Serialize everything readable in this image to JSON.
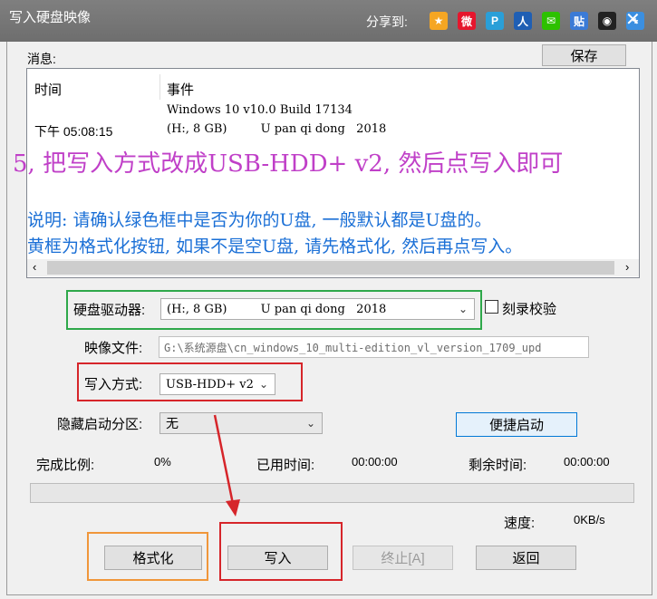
{
  "window": {
    "title": "写入硬盘映像",
    "share_label": "分享到:"
  },
  "share_icons": [
    {
      "icon": "qzone-star-icon",
      "glyph": "★",
      "color": "#f5a623"
    },
    {
      "icon": "weibo-icon",
      "glyph": "微",
      "color": "#e6162d"
    },
    {
      "icon": "tencent-weibo-icon",
      "glyph": "P",
      "color": "#2a9fd8"
    },
    {
      "icon": "renren-icon",
      "glyph": "人",
      "color": "#1f5fb4"
    },
    {
      "icon": "wechat-icon",
      "glyph": "✉",
      "color": "#2dc100"
    },
    {
      "icon": "tieba-icon",
      "glyph": "贴",
      "color": "#3b7bd6"
    },
    {
      "icon": "qq-penguin-icon",
      "glyph": "◉",
      "color": "#222222"
    },
    {
      "icon": "more-plus-icon",
      "glyph": "+",
      "color": "#3b8fe0"
    }
  ],
  "message": {
    "label": "消息:",
    "save_button": "保存",
    "col_time": "时间",
    "col_event": "事件",
    "rows": [
      {
        "time": "",
        "event": "Windows 10 v10.0 Build 17134"
      },
      {
        "time": "下午 05:08:15",
        "event": "(H:, 8 GB)         U pan qi dong   2018"
      }
    ]
  },
  "overlay": {
    "step": "5, 把写入方式改成USB-HDD+ v2, 然后点写入即可",
    "note1": "说明: 请确认绿色框中是否为你的U盘, 一般默认都是U盘的。",
    "note2": "黄框为格式化按钮, 如果不是空U盘, 请先格式化, 然后再点写入。"
  },
  "form": {
    "drive_label": "硬盘驱动器:",
    "drive_value": "(H:, 8 GB)         U pan qi dong   2018",
    "verify_label": "刻录校验",
    "image_label": "映像文件:",
    "image_value": "G:\\系统源盘\\cn_windows_10_multi-edition_vl_version_1709_upd",
    "write_mode_label": "写入方式:",
    "write_mode_value": "USB-HDD+ v2",
    "hidden_partition_label": "隐藏启动分区:",
    "hidden_partition_value": "无",
    "quick_boot_button": "便捷启动"
  },
  "status": {
    "complete_label": "完成比例:",
    "complete_value": "0%",
    "elapsed_label": "已用时间:",
    "elapsed_value": "00:00:00",
    "remaining_label": "剩余时间:",
    "remaining_value": "00:00:00",
    "speed_label": "速度:",
    "speed_value": "0KB/s",
    "progress": 0
  },
  "buttons": {
    "format": "格式化",
    "write": "写入",
    "stop": "终止[A]",
    "back": "返回"
  }
}
